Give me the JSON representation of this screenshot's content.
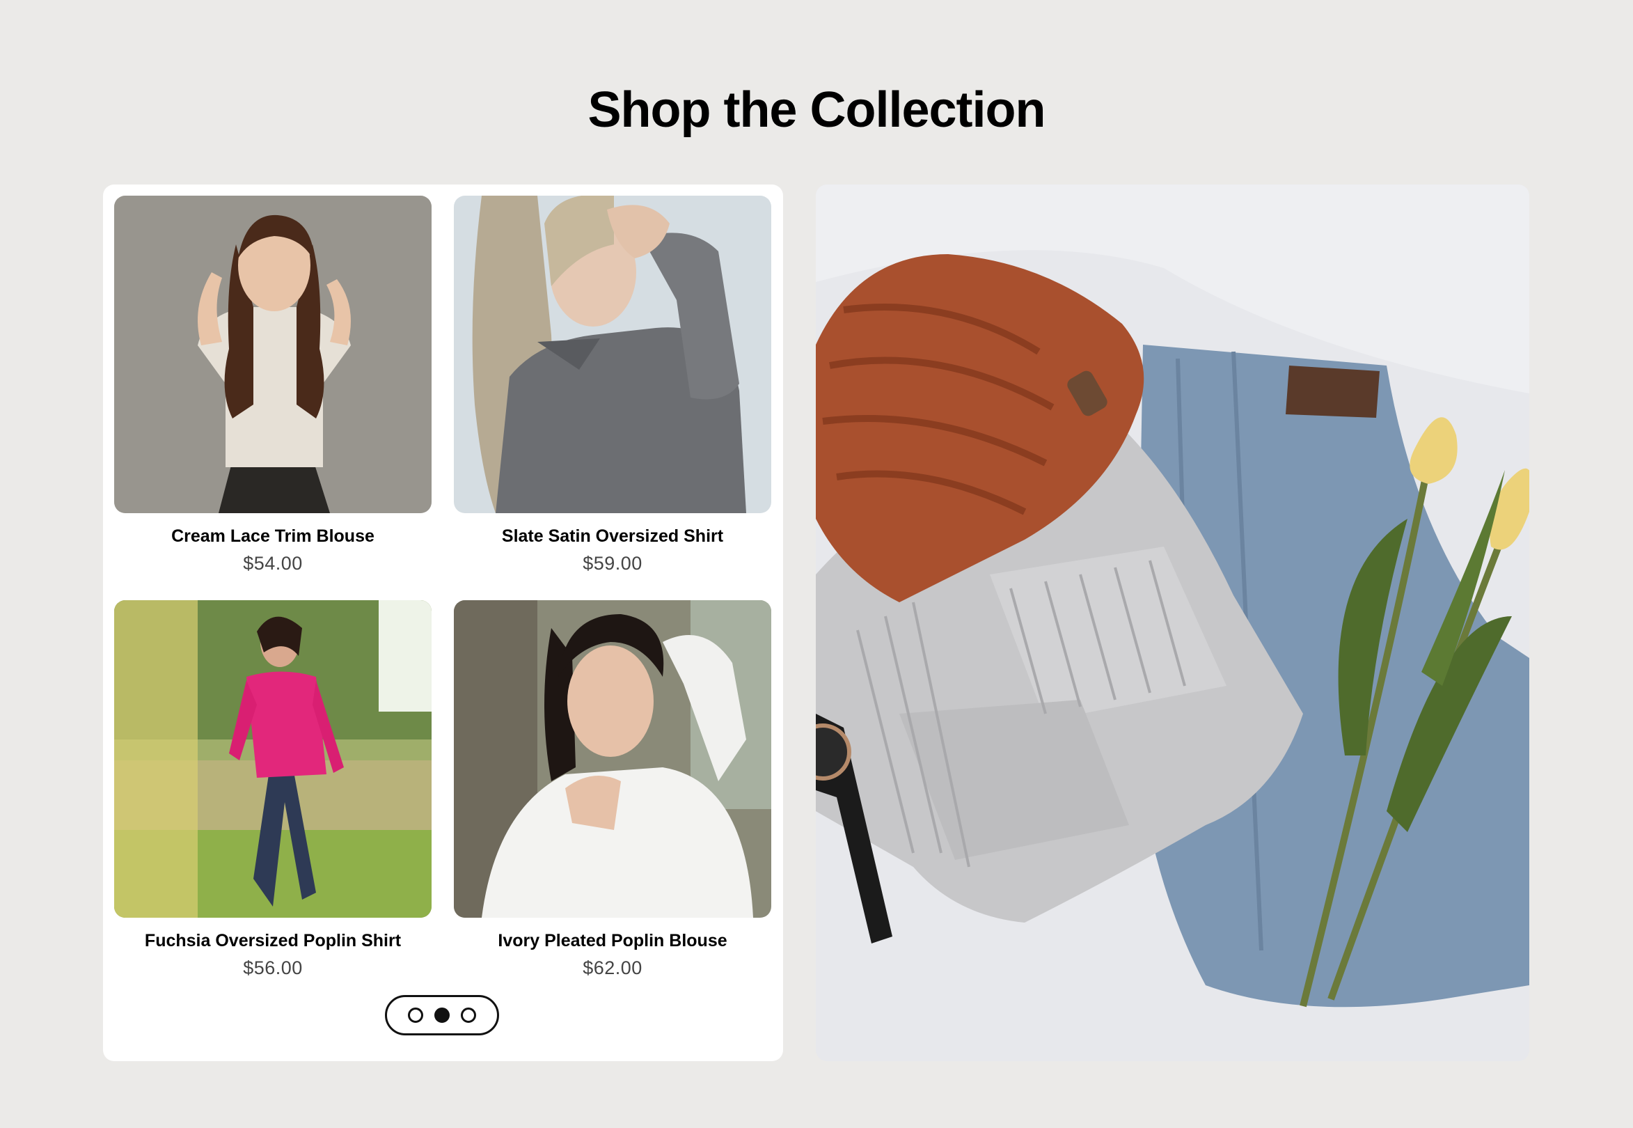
{
  "section": {
    "title": "Shop the Collection"
  },
  "products": [
    {
      "name": "Cream Lace Trim Blouse",
      "price": "$54.00",
      "image_icon": "woman-cream-blouse-photo"
    },
    {
      "name": "Slate Satin Oversized Shirt",
      "price": "$59.00",
      "image_icon": "woman-slate-shirt-photo"
    },
    {
      "name": "Fuchsia Oversized Poplin Shirt",
      "price": "$56.00",
      "image_icon": "woman-fuchsia-shirt-photo"
    },
    {
      "name": "Ivory Pleated Poplin Blouse",
      "price": "$62.00",
      "image_icon": "woman-ivory-blouse-photo"
    }
  ],
  "pager": {
    "page_count": 3,
    "active_index": 1
  },
  "lifestyle": {
    "image_icon": "flatlay-sweater-jeans-beanie-tulips-photo"
  },
  "colors": {
    "page_background": "#ebeae8",
    "panel_background": "#ffffff",
    "text": "#000000",
    "price_text": "#444444",
    "pager_accent": "#111111"
  }
}
